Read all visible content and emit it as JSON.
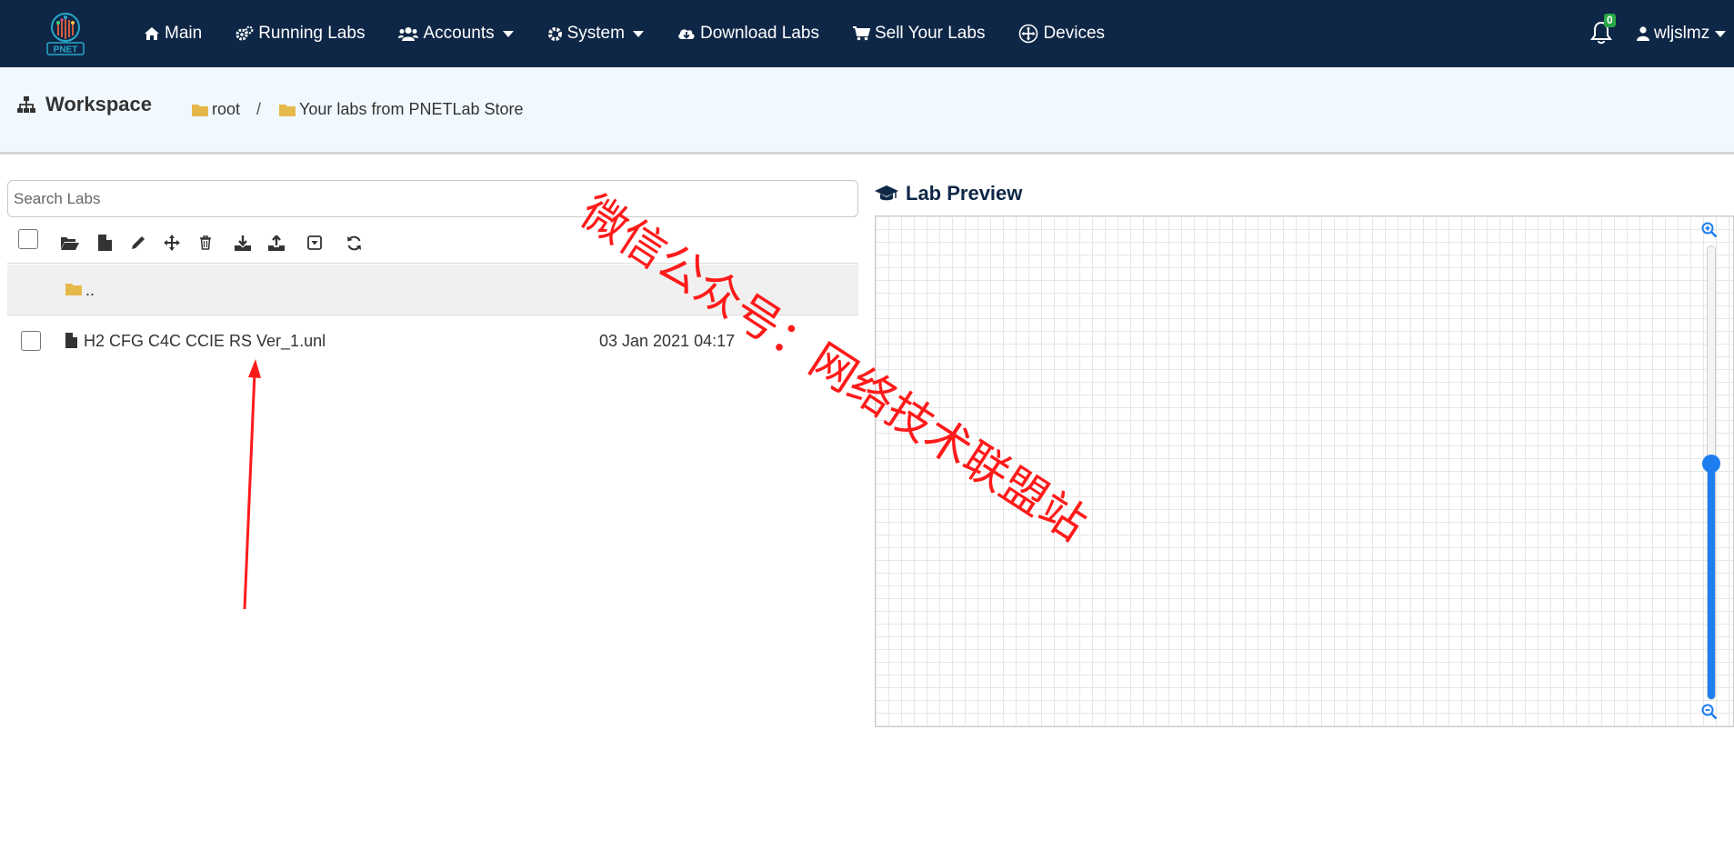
{
  "navbar": {
    "logo_text": "PNET",
    "items": [
      {
        "label": "Main",
        "icon": "home-icon"
      },
      {
        "label": "Running Labs",
        "icon": "gears-icon"
      },
      {
        "label": "Accounts",
        "icon": "users-icon",
        "dropdown": true
      },
      {
        "label": "System",
        "icon": "gear-icon",
        "dropdown": true
      },
      {
        "label": "Download Labs",
        "icon": "cloud-download-icon"
      },
      {
        "label": "Sell Your Labs",
        "icon": "cart-icon"
      },
      {
        "label": "Devices",
        "icon": "arrows-circle-icon"
      }
    ],
    "notification_count": "0",
    "username": "wljslmz"
  },
  "workspace": {
    "title": "Workspace",
    "breadcrumb": [
      {
        "label": "root"
      },
      {
        "label": "Your labs from PNETLab Store"
      }
    ],
    "separator": "/"
  },
  "lab_list": {
    "search_placeholder": "Search Labs",
    "parent_label": "..",
    "files": [
      {
        "name": "H2 CFG C4C CCIE RS Ver_1.unl",
        "date": "03 Jan 2021 04:17"
      }
    ]
  },
  "preview": {
    "title": "Lab Preview",
    "zoom_level": 0.52
  },
  "annotation": {
    "watermark": "微信公众号：网络技术联盟站"
  },
  "colors": {
    "navbar_bg": "#0f2747",
    "workspace_bg": "#f1f9ff",
    "folder": "#e6b84a",
    "accent": "#1e7ef0",
    "badge": "#28a745",
    "watermark": "#ff1a1a"
  }
}
